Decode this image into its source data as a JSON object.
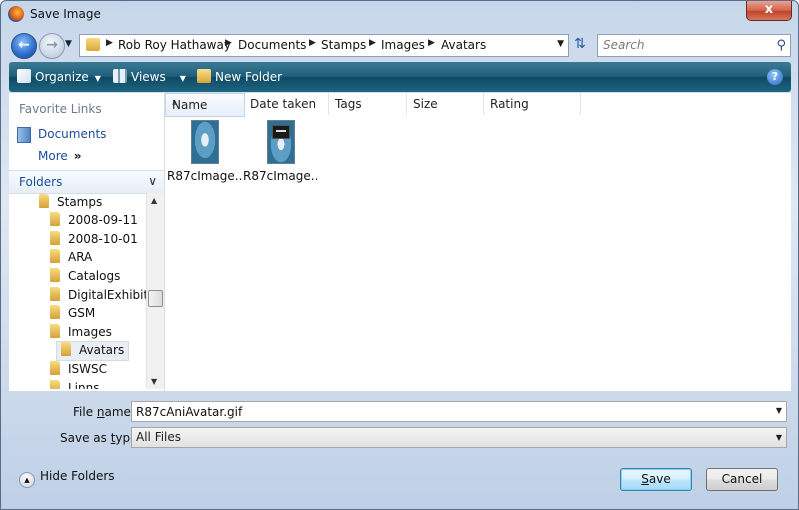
{
  "window": {
    "title": "Save Image",
    "close_label": "x"
  },
  "nav": {
    "crumbs": [
      "Rob Roy Hathaway",
      "Documents",
      "Stamps",
      "Images",
      "Avatars"
    ],
    "search_placeholder": "Search"
  },
  "toolbar": {
    "organize": "Organize",
    "views": "Views",
    "new_folder": "New Folder",
    "help": "?"
  },
  "left": {
    "favorite_links_header": "Favorite Links",
    "favorites": [
      "Documents",
      "More"
    ],
    "folders_header": "Folders",
    "tree": [
      {
        "label": "Stamps",
        "level": 0
      },
      {
        "label": "2008-09-11",
        "level": 1
      },
      {
        "label": "2008-10-01",
        "level": 1
      },
      {
        "label": "ARA",
        "level": 1
      },
      {
        "label": "Catalogs",
        "level": 1
      },
      {
        "label": "DigitalExhibits",
        "level": 1
      },
      {
        "label": "GSM",
        "level": 1
      },
      {
        "label": "Images",
        "level": 1
      },
      {
        "label": "Avatars",
        "level": 2,
        "selected": true
      },
      {
        "label": "ISWSC",
        "level": 1
      },
      {
        "label": "Linns",
        "level": 1
      }
    ]
  },
  "files": {
    "columns": [
      "Name",
      "Date taken",
      "Tags",
      "Size",
      "Rating"
    ],
    "items": [
      {
        "name": "R87cImage...",
        "badge": false
      },
      {
        "name": "R87cImage...",
        "badge": true
      }
    ]
  },
  "bottom": {
    "file_name_label_pre": "File ",
    "file_name_label_key": "n",
    "file_name_label_post": "ame:",
    "file_name_value": "R87cAniAvatar.gif",
    "save_type_label_pre": "Save as ",
    "save_type_label_key": "t",
    "save_type_label_post": "ype:",
    "save_type_value": "All Files",
    "hide_folders": "Hide Folders",
    "save_key": "S",
    "save_rest": "ave",
    "cancel": "Cancel"
  }
}
